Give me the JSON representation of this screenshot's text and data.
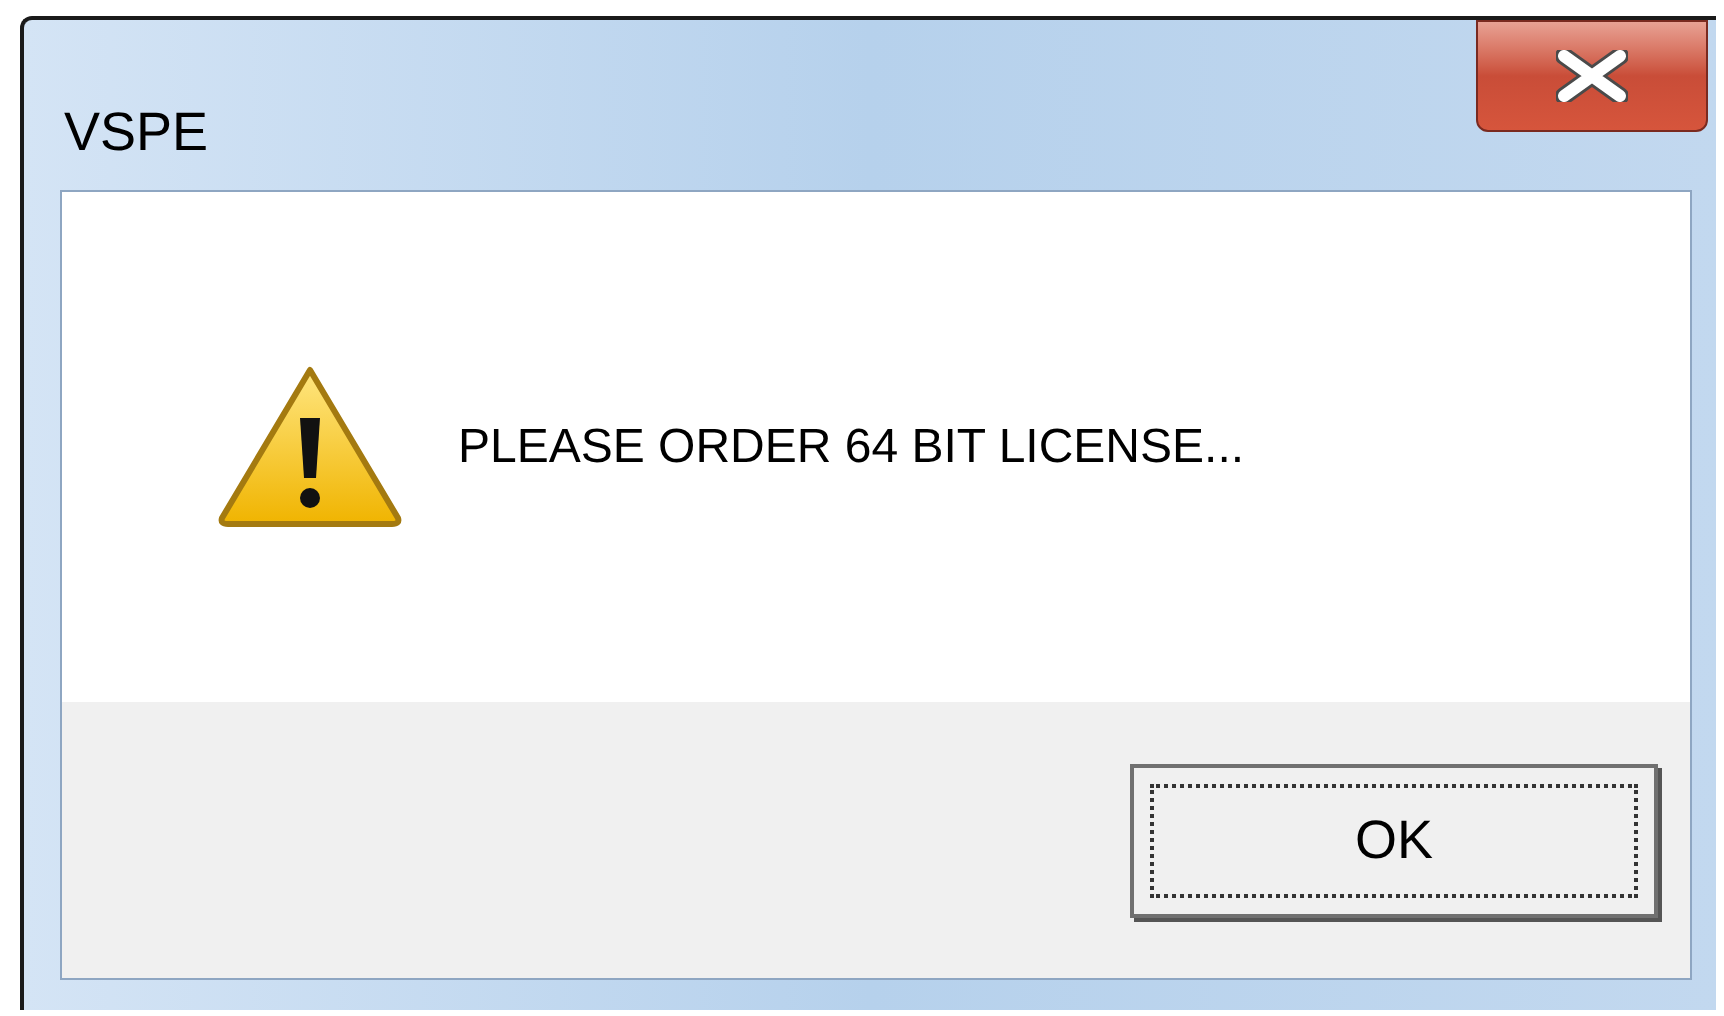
{
  "window": {
    "title": "VSPE"
  },
  "message": {
    "text": "PLEASE ORDER 64 BIT LICENSE..."
  },
  "buttons": [
    {
      "label": "OK",
      "focused": true
    }
  ]
}
